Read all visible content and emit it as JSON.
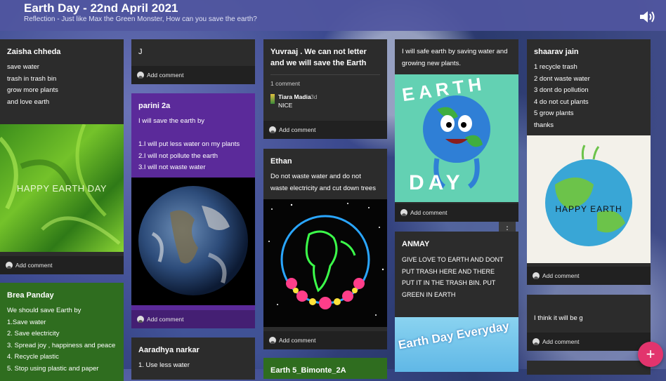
{
  "header": {
    "title": "Earth Day - 22nd April 2021",
    "subtitle": "Reflection - Just like Max the Green Monster, How can you save the earth?"
  },
  "common": {
    "add_comment": "Add comment",
    "add_icon": "+",
    "menu_icon": "⋮"
  },
  "cards": {
    "zaisha": {
      "title": "Zaisha chheda",
      "body": "save water\ntrash in trash bin\ngrow more plants\nand love earth",
      "image_text": "HAPPY EARTH DAY"
    },
    "brea": {
      "title": "Brea Panday",
      "body": "We should  save Earth by\n1.Save   water\n2. Save  electricity\n3. Spread joy , happiness and peace\n4. Recycle plastic\n5. Stop using plastic and paper"
    },
    "j": {
      "title": "J"
    },
    "parini": {
      "title": "parini 2a",
      "body": "I will save the earth by\n\n1.I will put less water on my plants\n2.I will not pollute the earth\n3.I will not waste water"
    },
    "aaradhya": {
      "title": "Aaradhya narkar",
      "body": "1. Use less water"
    },
    "yuvraaj": {
      "title": "Yuvraaj . We can not letter and we will save the Earth",
      "comment_count": "1 comment",
      "commenter": "Tiara Madia",
      "comment_time": "3d",
      "comment_text": "NICE"
    },
    "ethan": {
      "title": "Ethan",
      "body": "Do not waste water and do not waste electricity and cut down trees"
    },
    "earth5": {
      "title": "Earth 5_Bimonte_2A"
    },
    "safe": {
      "body": "I will safe earth by saving water and growing new plants.",
      "image_text_top": "EARTH",
      "image_text_bottom": "DAY"
    },
    "anmay": {
      "title": "ANMAY",
      "body": "GIVE LOVE TO EARTH   AND  DONT\nPUT  TRASH   HERE  AND THERE\nPUT IT IN THE TRASH  BIN.    PUT\nGREEN  IN EARTH",
      "image_text": "Earth Day Everyday"
    },
    "shaarav": {
      "title": "shaarav jain",
      "body": "1 recycle trash\n2 dont waste water\n3 dont do pollution\n4  do  not cut plants\n5 grow plants\nthanks",
      "image_text": "HAPPY EARTH"
    },
    "think": {
      "body": "I think it will be g"
    }
  }
}
